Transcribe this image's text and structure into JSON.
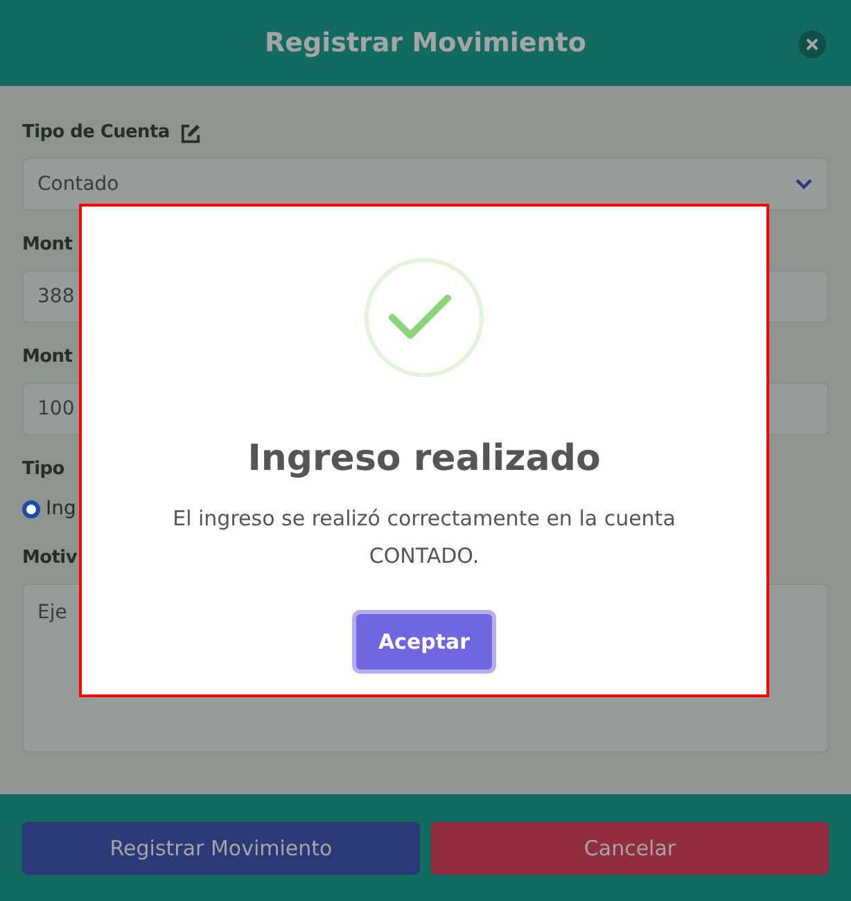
{
  "form": {
    "title": "Registrar Movimiento",
    "fields": [
      {
        "kind": "select",
        "label": "Tipo de Cuenta",
        "editable": true,
        "value": "Contado"
      },
      {
        "kind": "input",
        "label": "Mont",
        "value": "388"
      },
      {
        "kind": "input",
        "label": "Mont",
        "value": "100"
      },
      {
        "kind": "radio",
        "label": "Tipo",
        "options": [
          {
            "label": "Ing",
            "selected": true
          }
        ]
      },
      {
        "kind": "textarea",
        "label": "Motiv",
        "value": "Eje"
      }
    ],
    "buttons": [
      {
        "kind": "primary",
        "label": "Registrar Movimiento"
      },
      {
        "kind": "danger",
        "label": "Cancelar"
      }
    ]
  },
  "alert": {
    "kind": "success",
    "title": "Ingreso realizado",
    "message": "El ingreso se realizó correctamente en la cuenta CONTADO.",
    "button": "Aceptar"
  }
}
